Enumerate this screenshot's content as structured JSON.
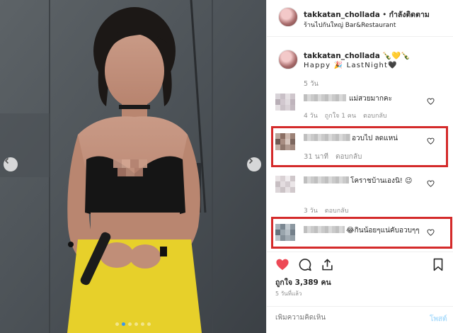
{
  "header": {
    "username": "takkatan_cholla",
    "username_suffix": "da",
    "separator": " • ",
    "following_label": "กำลังติดตาม",
    "location": "ร้านไปกันใหญ่ Bar&Restaurant"
  },
  "caption": {
    "username": "takkatan_chollada",
    "emoji": " 🍾💛🍾",
    "text": "Happy 🎉 LastNight🖤",
    "time": "5 วัน"
  },
  "comments": [
    {
      "text": "แม่สวยมากคะ",
      "time": "4 วัน",
      "likes": "ถูกใจ 1 คน",
      "reply": "ตอบกลับ"
    },
    {
      "text": "อวบไป ลดแหน่",
      "time": "31 นาที",
      "reply": "ตอบกลับ"
    },
    {
      "text": "โคราชบ้านเองนิ! 😉",
      "text2": "😉",
      "time": "3 วัน",
      "reply": "ตอบกลับ"
    },
    {
      "text": "😂กินน้อยๆแน่คับอวบๆๆ",
      "time": "",
      "reply": ""
    }
  ],
  "footer": {
    "likes": "ถูกใจ 3,389 คน",
    "posted": "5 วันที่แล้ว",
    "add_comment_placeholder": "เพิ่มความคิดเห็น",
    "post_label": "โพสต์"
  },
  "colors": {
    "highlight": "#d42a2a",
    "like": "#ed4956",
    "link": "#3897f0"
  },
  "icons": {
    "like": "heart-filled-icon",
    "comment": "comment-bubble-icon",
    "share": "share-icon",
    "save": "bookmark-icon"
  },
  "carousel": {
    "slides": 6,
    "active": 1
  }
}
